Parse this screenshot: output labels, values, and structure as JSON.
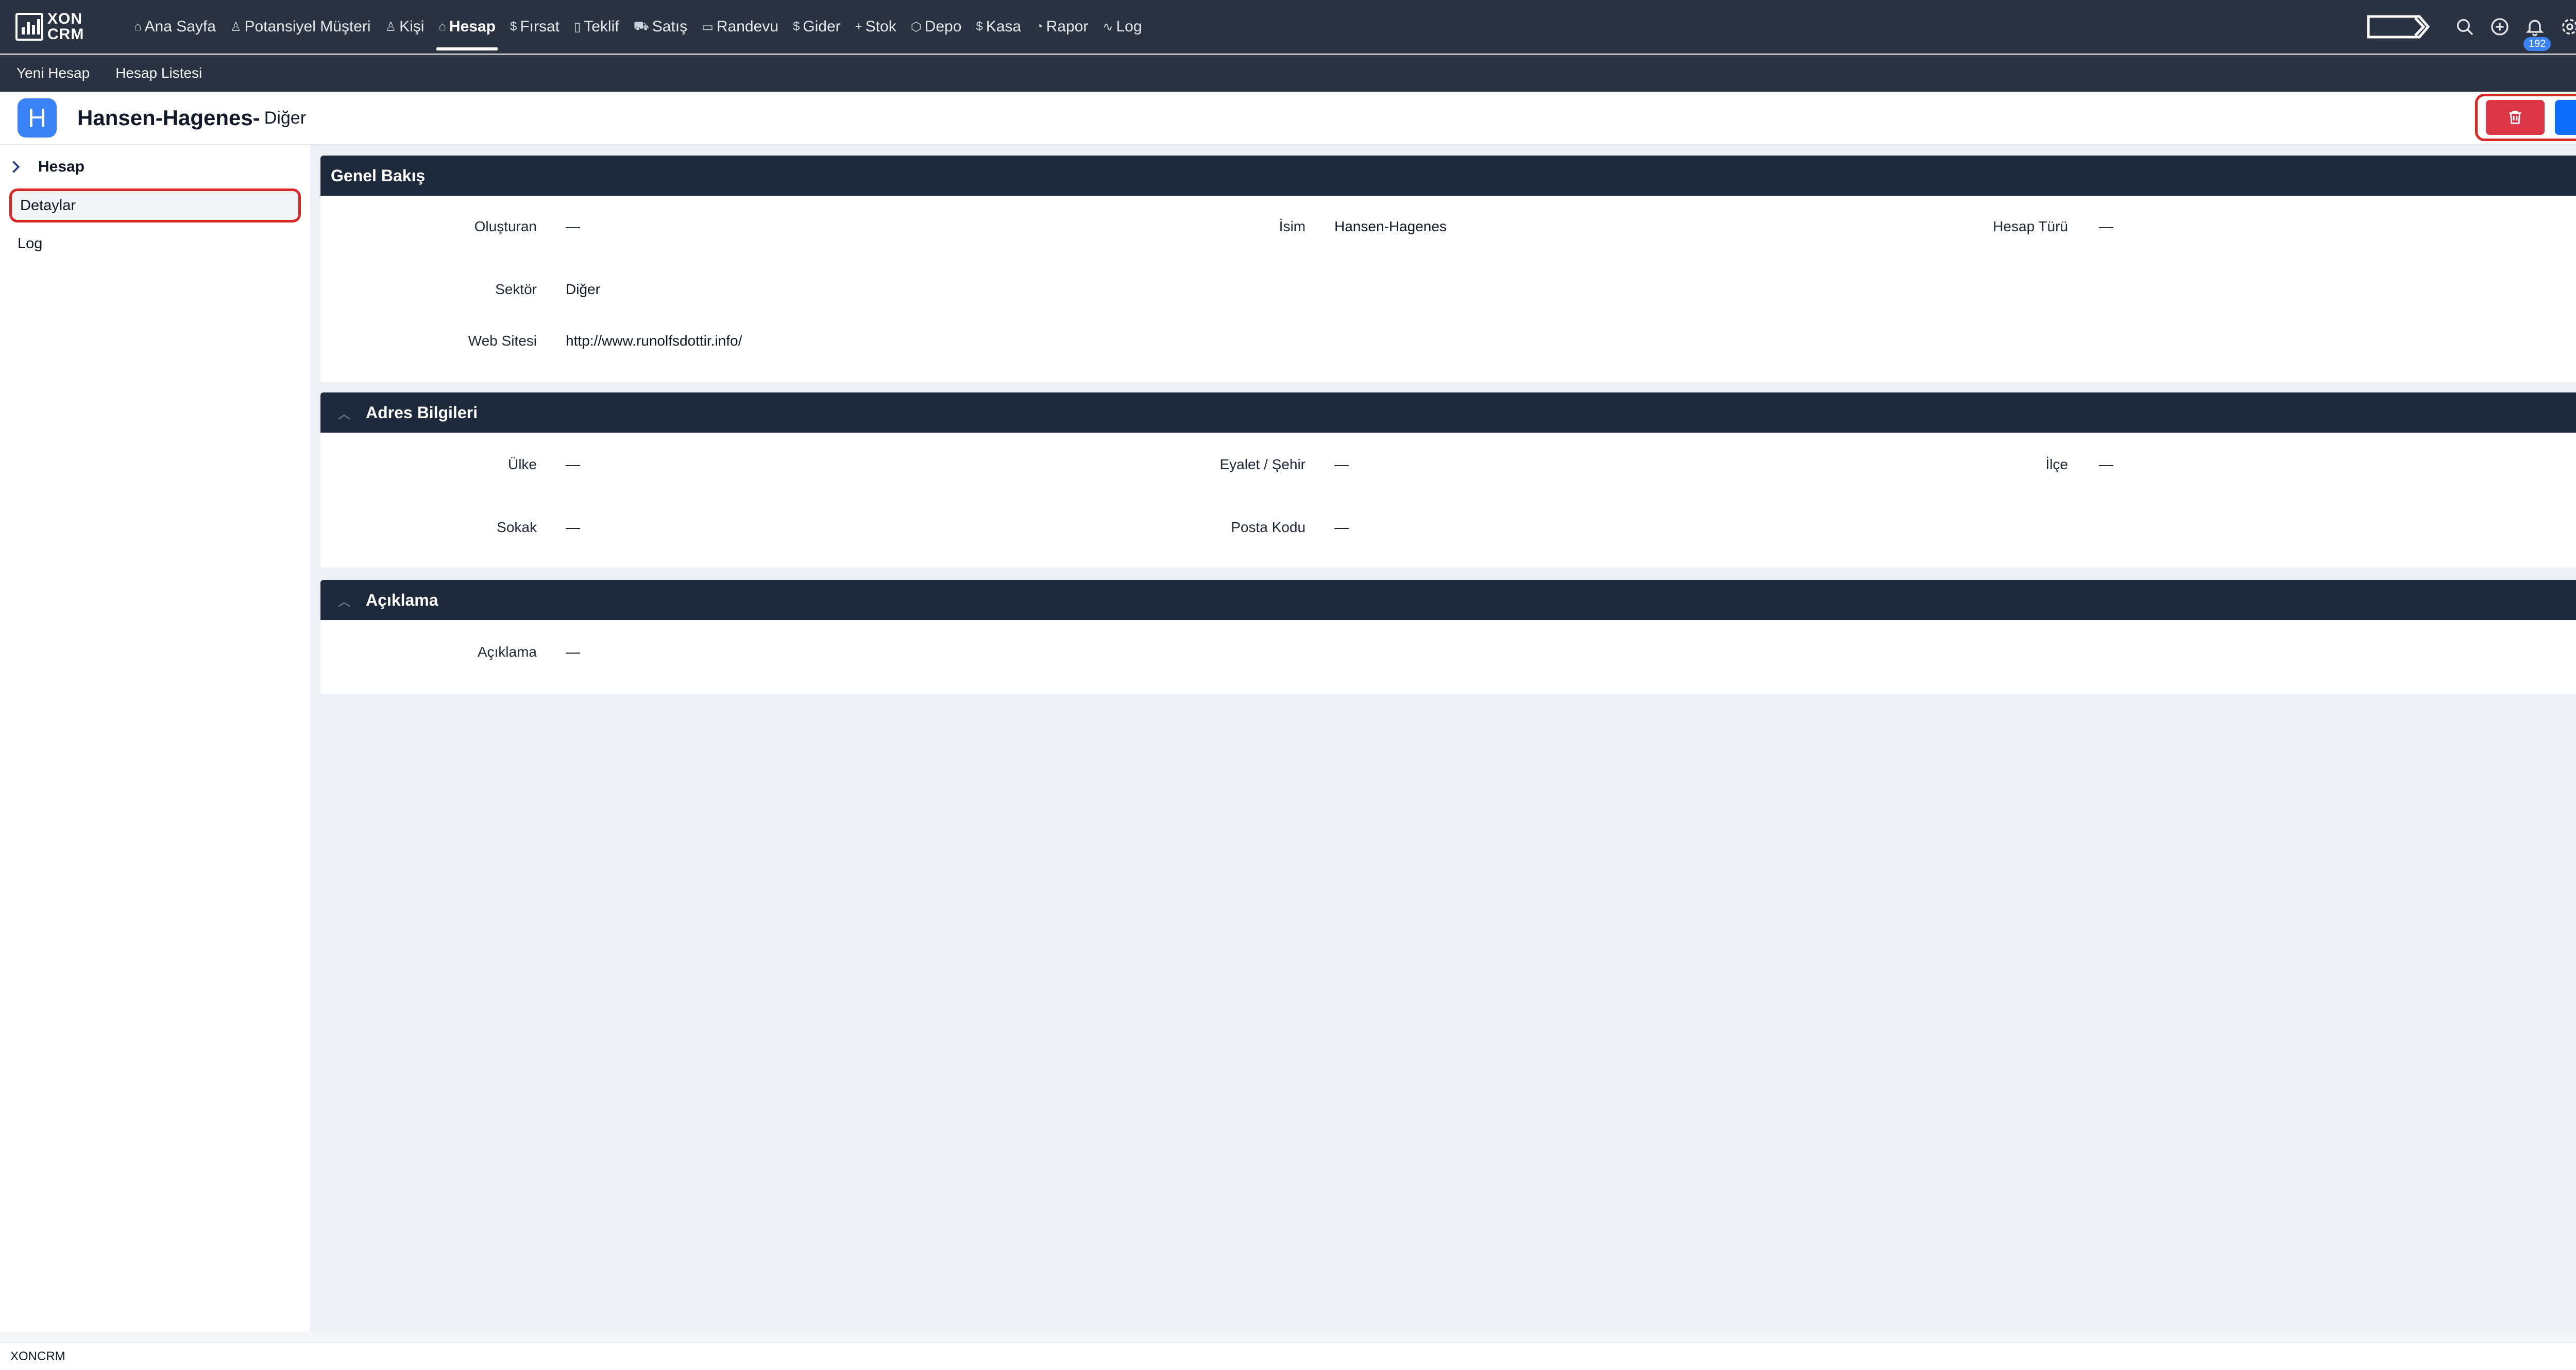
{
  "app": {
    "logo_line1": "XON",
    "logo_line2": "CRM"
  },
  "nav": {
    "items": [
      {
        "label": "Ana Sayfa",
        "icon": "⌂"
      },
      {
        "label": "Potansiyel Müşteri",
        "icon": "♙"
      },
      {
        "label": "Kişi",
        "icon": "♙"
      },
      {
        "label": "Hesap",
        "icon": "⌂"
      },
      {
        "label": "Fırsat",
        "icon": "$"
      },
      {
        "label": "Teklif",
        "icon": "▯"
      },
      {
        "label": "Satış",
        "icon": "⛟"
      },
      {
        "label": "Randevu",
        "icon": "▭"
      },
      {
        "label": "Gider",
        "icon": "$"
      },
      {
        "label": "Stok",
        "icon": "+"
      },
      {
        "label": "Depo",
        "icon": "⬡"
      },
      {
        "label": "Kasa",
        "icon": "$"
      },
      {
        "label": "Rapor",
        "icon": "◔"
      },
      {
        "label": "Log",
        "icon": "∿"
      }
    ],
    "active_index": 3,
    "notification_count": "192"
  },
  "subnav": {
    "new_account": "Yeni Hesap",
    "account_list": "Hesap Listesi"
  },
  "header": {
    "avatar_letter": "H",
    "title": "Hansen-Hagenes-",
    "subtitle": "Diğer"
  },
  "sidebar": {
    "section": "Hesap",
    "items": [
      {
        "label": "Detaylar"
      },
      {
        "label": "Log"
      }
    ]
  },
  "overview": {
    "title": "Genel Bakış",
    "created_by_label": "Oluşturan",
    "created_by": "—",
    "name_label": "İsim",
    "name": "Hansen-Hagenes",
    "account_type_label": "Hesap Türü",
    "account_type": "—",
    "sector_label": "Sektör",
    "sector": "Diğer",
    "website_label": "Web Sitesi",
    "website": "http://www.runolfsdottir.info/"
  },
  "address": {
    "title": "Adres Bilgileri",
    "country_label": "Ülke",
    "country": "—",
    "state_label": "Eyalet / Şehir",
    "state": "—",
    "district_label": "İlçe",
    "district": "—",
    "street_label": "Sokak",
    "street": "—",
    "postal_label": "Posta Kodu",
    "postal": "—"
  },
  "description": {
    "title": "Açıklama",
    "label": "Açıklama",
    "value": "—"
  },
  "footer": {
    "text": "XONCRM"
  },
  "colors": {
    "nav_bg": "#2b3241",
    "card_head": "#1e2a3b",
    "delete": "#dc3545",
    "edit": "#0d6efd",
    "highlight": "#dc2626"
  }
}
